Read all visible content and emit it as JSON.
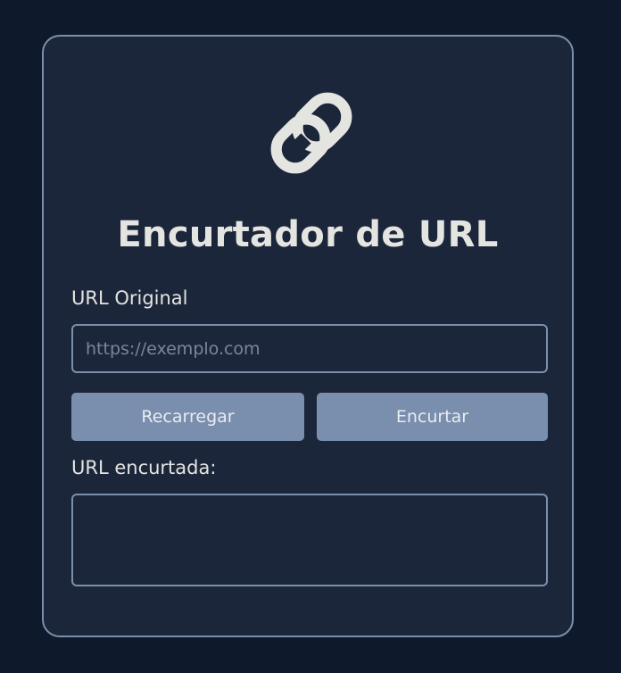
{
  "header": {
    "logo_icon": "link-icon",
    "title": "Encurtador de URL"
  },
  "form": {
    "original_label": "URL Original",
    "original_placeholder": "https://exemplo.com",
    "original_value": "",
    "reload_button": "Recarregar",
    "shorten_button": "Encurtar",
    "short_label": "URL encurtada:",
    "short_value": ""
  },
  "colors": {
    "page_background": "#0e1a2b",
    "card_background": "#1c263a",
    "border": "#7b8fad",
    "button": "#7a8ead",
    "text": "#e4e4e1",
    "placeholder": "#7c869a"
  }
}
